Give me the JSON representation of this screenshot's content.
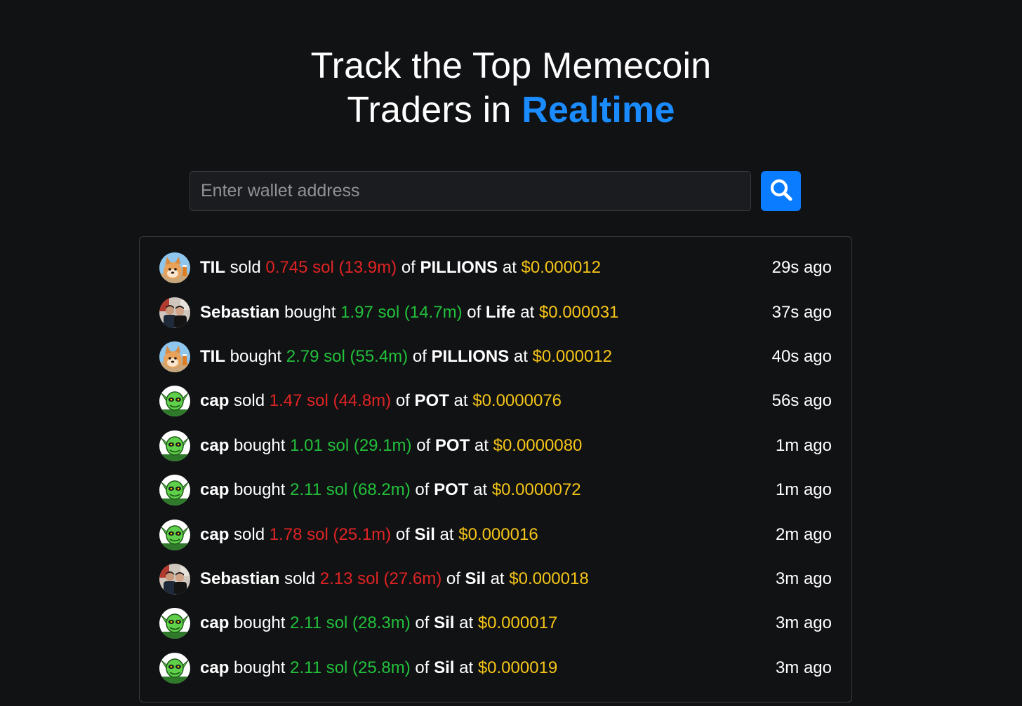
{
  "hero": {
    "line1": "Track the Top Memecoin",
    "line2_prefix": "Traders in ",
    "line2_accent": "Realtime"
  },
  "search": {
    "placeholder": "Enter wallet address",
    "value": "",
    "button_icon": "search-icon"
  },
  "colors": {
    "background": "#111214",
    "accent_blue": "#1a8cff",
    "button_blue": "#0a7cff",
    "sold_red": "#e02424",
    "bought_green": "#22c03b",
    "price_yellow": "#f5c518",
    "text_white": "#ffffff",
    "border_gray": "#3a3b3f"
  },
  "words": {
    "of": "of",
    "at": "at"
  },
  "avatars": {
    "TIL": "dog-avatar",
    "Sebastian": "photo-avatar",
    "cap": "green-goblin-avatar"
  },
  "trades": [
    {
      "trader": "TIL",
      "action": "sold",
      "amount": "0.745 sol (13.9m)",
      "token": "PILLIONS",
      "price": "$0.000012",
      "time": "29s ago"
    },
    {
      "trader": "Sebastian",
      "action": "bought",
      "amount": "1.97 sol (14.7m)",
      "token": "Life",
      "price": "$0.000031",
      "time": "37s ago"
    },
    {
      "trader": "TIL",
      "action": "bought",
      "amount": "2.79 sol (55.4m)",
      "token": "PILLIONS",
      "price": "$0.000012",
      "time": "40s ago"
    },
    {
      "trader": "cap",
      "action": "sold",
      "amount": "1.47 sol (44.8m)",
      "token": "POT",
      "price": "$0.0000076",
      "time": "56s ago"
    },
    {
      "trader": "cap",
      "action": "bought",
      "amount": "1.01 sol (29.1m)",
      "token": "POT",
      "price": "$0.0000080",
      "time": "1m ago"
    },
    {
      "trader": "cap",
      "action": "bought",
      "amount": "2.11 sol (68.2m)",
      "token": "POT",
      "price": "$0.0000072",
      "time": "1m ago"
    },
    {
      "trader": "cap",
      "action": "sold",
      "amount": "1.78 sol (25.1m)",
      "token": "Sil",
      "price": "$0.000016",
      "time": "2m ago"
    },
    {
      "trader": "Sebastian",
      "action": "sold",
      "amount": "2.13 sol (27.6m)",
      "token": "Sil",
      "price": "$0.000018",
      "time": "3m ago"
    },
    {
      "trader": "cap",
      "action": "bought",
      "amount": "2.11 sol (28.3m)",
      "token": "Sil",
      "price": "$0.000017",
      "time": "3m ago"
    },
    {
      "trader": "cap",
      "action": "bought",
      "amount": "2.11 sol (25.8m)",
      "token": "Sil",
      "price": "$0.000019",
      "time": "3m ago"
    }
  ]
}
